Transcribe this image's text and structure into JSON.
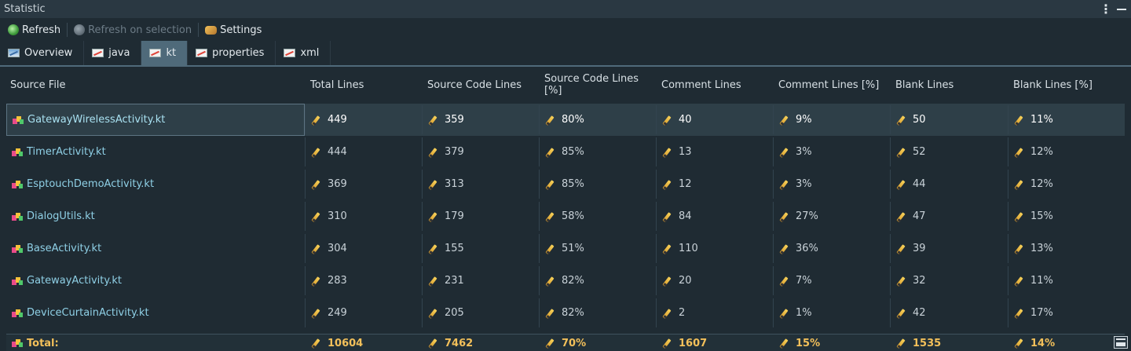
{
  "window": {
    "title": "Statistic",
    "menu_icon": "kebab-icon",
    "minimize_icon": "minimize-icon"
  },
  "toolbar": {
    "refresh_label": "Refresh",
    "refresh_selection_label": "Refresh on selection",
    "settings_label": "Settings"
  },
  "tabs": [
    {
      "label": "Overview",
      "active": false
    },
    {
      "label": "java",
      "active": false
    },
    {
      "label": "kt",
      "active": true
    },
    {
      "label": "properties",
      "active": false
    },
    {
      "label": "xml",
      "active": false
    }
  ],
  "table": {
    "headers": [
      "Source File",
      "Total Lines",
      "Source Code Lines",
      "Source Code Lines [%]",
      "Comment Lines",
      "Comment Lines [%]",
      "Blank Lines",
      "Blank Lines [%]"
    ],
    "rows": [
      [
        "GatewayWirelessActivity.kt",
        "449",
        "359",
        "80%",
        "40",
        "9%",
        "50",
        "11%"
      ],
      [
        "TimerActivity.kt",
        "444",
        "379",
        "85%",
        "13",
        "3%",
        "52",
        "12%"
      ],
      [
        "EsptouchDemoActivity.kt",
        "369",
        "313",
        "85%",
        "12",
        "3%",
        "44",
        "12%"
      ],
      [
        "DialogUtils.kt",
        "310",
        "179",
        "58%",
        "84",
        "27%",
        "47",
        "15%"
      ],
      [
        "BaseActivity.kt",
        "304",
        "155",
        "51%",
        "110",
        "36%",
        "39",
        "13%"
      ],
      [
        "GatewayActivity.kt",
        "283",
        "231",
        "82%",
        "20",
        "7%",
        "32",
        "11%"
      ],
      [
        "DeviceCurtainActivity.kt",
        "249",
        "205",
        "82%",
        "2",
        "1%",
        "42",
        "17%"
      ]
    ],
    "selected_row": 0,
    "total": [
      "Total:",
      "10604",
      "7462",
      "70%",
      "1607",
      "15%",
      "1535",
      "14%"
    ]
  },
  "colors": {
    "background": "#1f2b33",
    "active_tab": "#4f6a7a",
    "total_text": "#f3c05a",
    "file_text": "#8fd0e6"
  }
}
